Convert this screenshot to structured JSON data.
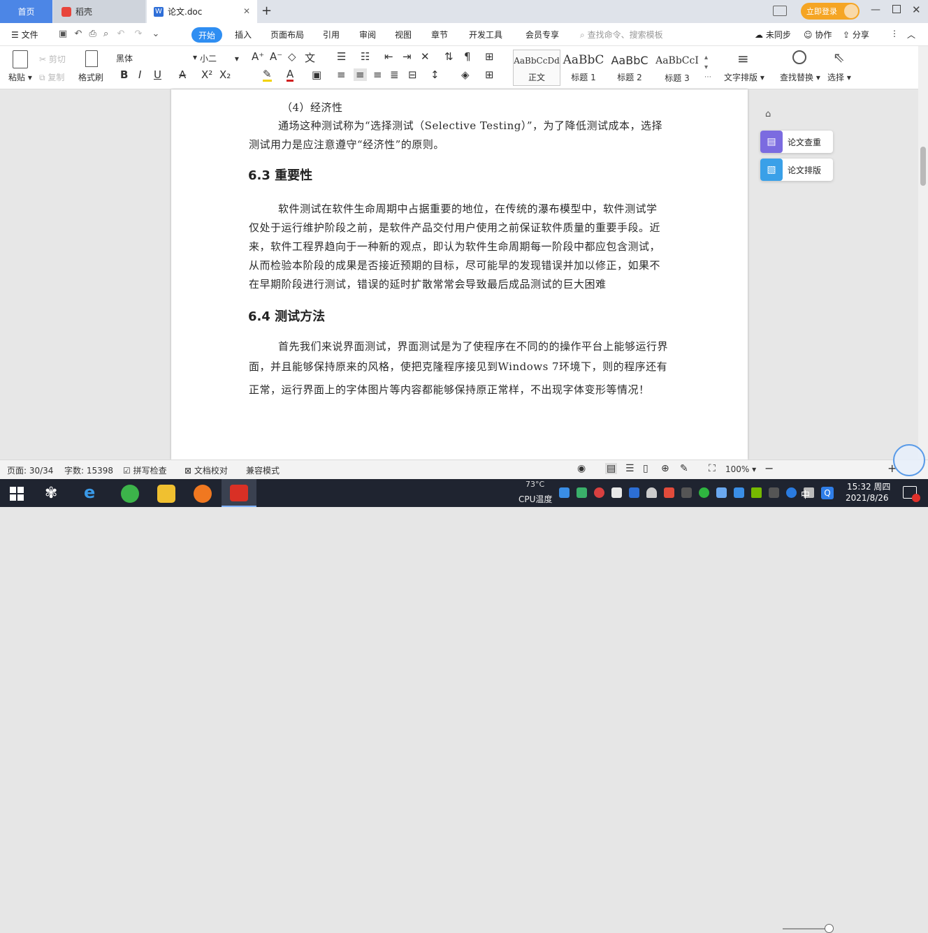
{
  "tabs": {
    "home": "首页",
    "daoke": "稻壳",
    "doc": "论文.doc",
    "new_tab": "+",
    "login": "立即登录"
  },
  "menu": {
    "file": "文件",
    "items": [
      "开始",
      "插入",
      "页面布局",
      "引用",
      "审阅",
      "视图",
      "章节",
      "开发工具",
      "会员专享"
    ],
    "search_placeholder": "查找命令、搜索模板",
    "sync": "未同步",
    "collab": "协作",
    "share": "分享"
  },
  "ribbon": {
    "paste": "粘贴",
    "cut": "剪切",
    "copy": "复制",
    "format_painter": "格式刷",
    "font_name": "黑体",
    "font_size": "小二",
    "styles": [
      {
        "preview": "AaBbCcDd",
        "label": "正文"
      },
      {
        "preview": "AaBbC",
        "label": "标题 1"
      },
      {
        "preview": "AaBbC",
        "label": "标题 2"
      },
      {
        "preview": "AaBbCcI",
        "label": "标题 3"
      }
    ],
    "text_layout": "文字排版",
    "find_replace": "查找替换",
    "select": "选择"
  },
  "document": {
    "item4": "（4）经济性",
    "p1_line1": "通场这种测试称为“选择测试（Selective Testing）”，为了降低测试成本，选择",
    "p1_line2": "测试用力是应注意遵守“经济性”的原则。",
    "h63": "6.3 重要性",
    "p2_line1": "软件测试在软件生命周期中占据重要的地位，在传统的瀑布模型中，软件测试学",
    "p2_line2": "仅处于运行维护阶段之前，是软件产品交付用户使用之前保证软件质量的重要手段。近",
    "p2_line3": "来，软件工程界趋向于一种新的观点，即认为软件生命周期每一阶段中都应包含测试，",
    "p2_line4": "从而检验本阶段的成果是否接近预期的目标，尽可能早的发现错误并加以修正，如果不",
    "p2_line5": "在早期阶段进行测试，错误的延时扩散常常会导致最后成品测试的巨大困难",
    "h64": "6.4 测试方法",
    "p3_line1": "首先我们来说界面测试，界面测试是为了使程序在不同的的操作平台上能够运行界",
    "p3_line2": "面，并且能够保持原来的风格，使把克隆程序接见到Windows 7环境下，则的程序还有",
    "p3_line3": "正常，运行界面上的字体图片等内容都能够保持原正常样，不出现字体变形等情况！"
  },
  "side_panel": {
    "check": "论文查重",
    "layout": "论文排版"
  },
  "status": {
    "page": "页面: 30/34",
    "words": "字数: 15398",
    "spell": "拼写检查",
    "proof": "文档校对",
    "compat": "兼容模式",
    "zoom": "100%"
  },
  "taskbar": {
    "temp": "73°C",
    "cpu": "CPU温度",
    "ime": "中",
    "time": "15:32 周四",
    "date": "2021/8/26"
  },
  "colors": {
    "accent": "#4c86e6",
    "start_tab": "#2f8ef2",
    "login": "#f5a524",
    "taskbar": "#1f2430"
  }
}
